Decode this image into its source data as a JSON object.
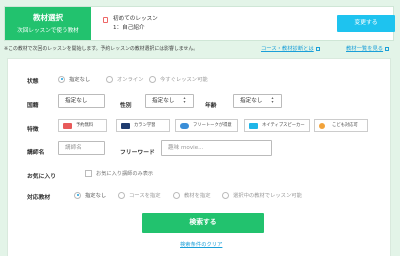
{
  "banner": {
    "tag_title": "教材選択",
    "tag_sub": "次回レッスンで使う教材",
    "lesson_title": "初めてのレッスン",
    "lesson_sub": "1：自己紹介",
    "change_label": "変更する"
  },
  "notice": "※この教材で次回のレッスンを開始します。予約レッスンの教材選択には影響しません。",
  "links": {
    "course_diagnosis": "コース・教材診断とは",
    "material_list": "教材一覧を見る"
  },
  "filters": {
    "status_label": "状態",
    "status_options": [
      {
        "label": "指定なし",
        "selected": true
      },
      {
        "label": "オンライン",
        "selected": false
      },
      {
        "label": "今すぐレッスン可能",
        "selected": false
      }
    ],
    "country_label": "国籍",
    "country_value": "指定なし",
    "gender_label": "性別",
    "gender_value": "指定なし",
    "age_label": "年齢",
    "age_value": "指定なし",
    "feature_label": "特徴",
    "features": [
      {
        "label": "予約無料",
        "icon": "reservation-icon",
        "color": "#e85a5a"
      },
      {
        "label": "カラン学習",
        "icon": "callan-icon",
        "color": "#1f3b6e"
      },
      {
        "label": "フリートークが得意",
        "icon": "chat-icon",
        "color": "#3a8ed8"
      },
      {
        "label": "ネイティブスピーカー",
        "icon": "native-icon",
        "color": "#1fb5e8"
      },
      {
        "label": "こども対応可",
        "icon": "kids-icon",
        "color": "#f2a33a"
      }
    ],
    "teacher_label": "講師名",
    "teacher_placeholder": "講師名",
    "freeword_label": "フリーワード",
    "freeword_placeholder": "趣味 movie...",
    "favorite_label": "お気に入り",
    "favorite_checkbox": "お気に入り講師のみ表示",
    "material_label": "対応教材",
    "material_options": [
      {
        "label": "指定なし",
        "selected": true
      },
      {
        "label": "コースを指定",
        "selected": false
      },
      {
        "label": "教材を指定",
        "selected": false
      },
      {
        "label": "選択中の教材でレッスン可能",
        "selected": false
      }
    ]
  },
  "search_button": "検索する",
  "clear_link": "検索条件のクリア"
}
